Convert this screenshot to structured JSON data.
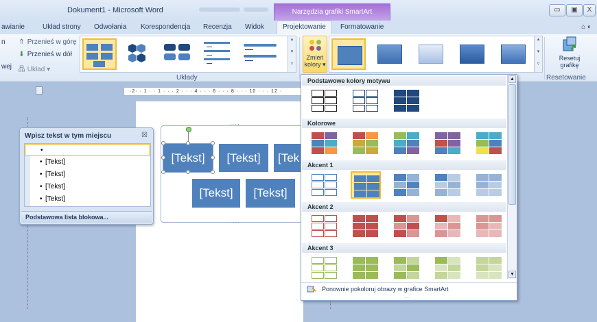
{
  "window": {
    "title": "Dokument1 - Microsoft Word",
    "context_tab": "Narzędzia grafiki SmartArt",
    "buttons": [
      "▭",
      "▣",
      "X"
    ]
  },
  "tabs": [
    {
      "label": "awianie"
    },
    {
      "label": "Układ strony"
    },
    {
      "label": "Odwołania"
    },
    {
      "label": "Korespondencja"
    },
    {
      "label": "Recenzja"
    },
    {
      "label": "Widok"
    },
    {
      "label": "Projektowanie",
      "active": true
    },
    {
      "label": "Formatowanie"
    }
  ],
  "ribbon": {
    "move_up": "Przenieś w górę",
    "move_down": "Przenieś w dół",
    "left_cut": "n",
    "left_cut2": "wej",
    "layout_label": "Układ",
    "layouts_group": "Układy",
    "change_colors_line1": "Zmień",
    "change_colors_line2": "kolory",
    "reset_line1": "Resetuj",
    "reset_line2": "grafikę",
    "reset_group": "Resetowanie"
  },
  "ruler": {
    "text": "·2· · 1 ·   · 1 · · · 2 · · · 4 · · · 6 · · · 8 · · · 10 · · · 12 ·"
  },
  "smartart": {
    "boxes": [
      "[Tekst]",
      "[Tekst]",
      "[Tek",
      "[Tekst]",
      "[Tekst]"
    ],
    "frame_dots": "····"
  },
  "text_pane": {
    "title": "Wpisz tekst w tym miejscu",
    "close": "☒",
    "items": [
      "",
      "[Tekst]",
      "[Tekst]",
      "[Tekst]",
      "[Tekst]"
    ],
    "bullet": "•",
    "footer": "Podstawowa lista blokowa..."
  },
  "color_menu": {
    "sections": [
      {
        "label": "Podstawowe kolory motywu"
      },
      {
        "label": "Kolorowe"
      },
      {
        "label": "Akcent 1"
      },
      {
        "label": "Akcent 2"
      },
      {
        "label": "Akcent 3"
      }
    ],
    "footer": "Ponownie pokoloruj obrazy w grafice SmartArt",
    "selected": "Akcent 1 - wariant 2"
  },
  "colors": {
    "accent1": "#4f81bd",
    "accent2": "#c0504d",
    "accent3": "#9bbb59",
    "dark": "#1f497d",
    "purple": "#8064a2",
    "aqua": "#4bacc6",
    "orange": "#f79646",
    "selection": "#f0bd3a"
  }
}
